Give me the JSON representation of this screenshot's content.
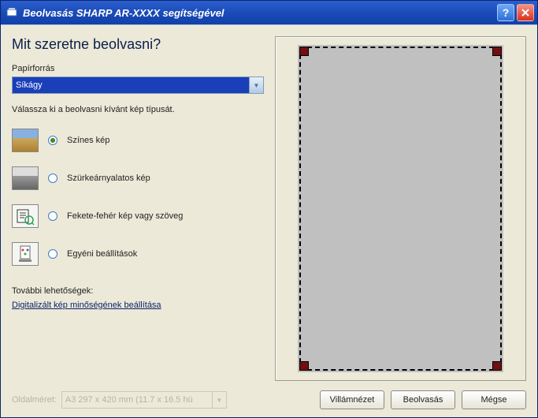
{
  "window": {
    "title": "Beolvasás SHARP AR-XXXX segítségével"
  },
  "main": {
    "heading": "Mit szeretne beolvasni?",
    "paperSourceLabel": "Papírforrás",
    "paperSourceSelected": "Síkágy",
    "instruction": "Válassza ki a beolvasni kívánt kép típusát.",
    "options": {
      "color": "Színes kép",
      "grayscale": "Szürkeárnyalatos kép",
      "bw": "Fekete-fehér kép vagy szöveg",
      "custom": "Egyéni beállítások"
    },
    "selectedOption": "color",
    "moreOptionsLabel": "További lehetőségek:",
    "qualityLink": "Digitalizált kép minőségének beállítása"
  },
  "footer": {
    "pageSizeLabel": "Oldalméret:",
    "pageSizeValue": "A3 297 x 420 mm (11.7 x 16.5 hü",
    "previewBtn": "Villámnézet",
    "scanBtn": "Beolvasás",
    "cancelBtn": "Mégse"
  }
}
